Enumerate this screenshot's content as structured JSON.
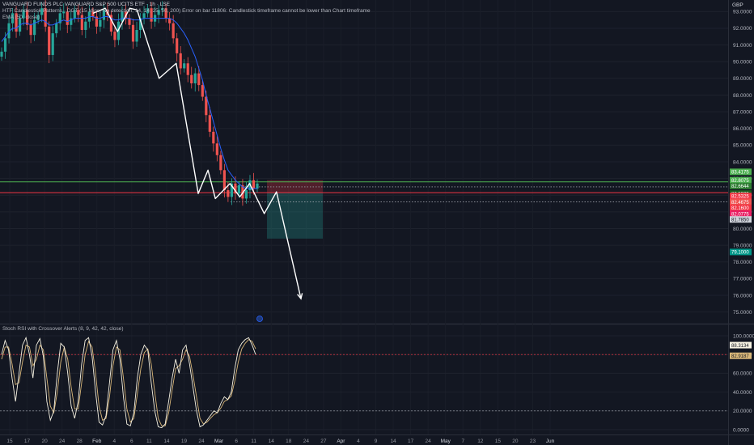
{
  "header": {
    "title": "VANGUARD FUNDS PLC VANGUARD S&P 500 UCITS ETF · 1h · LSE",
    "pattern_indicator": "HTF Candlestick Patterns · DGT (15 Mins, No detection, 14, 14, 25, 50, 200) Error on bar 11806: Candlestick timeframe cannot be lower than Chart timeframe",
    "ema_indicator": "EMA (50, close)",
    "currency": "GBP"
  },
  "chart_data": [
    {
      "type": "candlestick",
      "title": "VANGUARD FUNDS PLC VANGUARD S&P 500 UCITS ETF · 1h · LSE",
      "currency": "GBP",
      "yticks": [
        "93.0000",
        "92.0000",
        "91.0000",
        "90.0000",
        "89.0000",
        "88.0000",
        "87.0000",
        "86.0000",
        "85.0000",
        "84.0000",
        "83.0000",
        "82.0000",
        "81.0000",
        "80.0000",
        "79.0000",
        "78.0000",
        "77.0000",
        "76.0000",
        "75.0000"
      ],
      "ylim": [
        74.5,
        93.5
      ],
      "xticks": [
        "15",
        "17",
        "20",
        "24",
        "28",
        "Feb",
        "4",
        "6",
        "11",
        "14",
        "19",
        "24",
        "Mar",
        "6",
        "11",
        "14",
        "18",
        "24",
        "27",
        "Apr",
        "4",
        "9",
        "14",
        "17",
        "24",
        "May",
        "7",
        "12",
        "15",
        "20",
        "23",
        "Jun"
      ],
      "series": [
        {
          "type": "candles",
          "color_up": "#26a69a",
          "color_down": "#ef5350",
          "closes": [
            90.6,
            91.4,
            92.3,
            92.9,
            91.8,
            92.6,
            93.1,
            92.2,
            91.6,
            92.5,
            92.8,
            93.2,
            92.1,
            90.4,
            91.7,
            92.3,
            92.9,
            93.0,
            92.2,
            92.6,
            93.1,
            92.8,
            91.9,
            92.4,
            93.0,
            92.7,
            92.1,
            92.5,
            93.1,
            92.8,
            91.8,
            91.3,
            92.4,
            93.0,
            92.6,
            92.2,
            91.2,
            91.9,
            92.6,
            92.9,
            93.2,
            92.4,
            92.8,
            93.1,
            93.2,
            92.6,
            92.3,
            91.4,
            90.5,
            89.6,
            89.9,
            89.2,
            88.7,
            89.3,
            88.6,
            87.9,
            86.8,
            85.8,
            85.1,
            84.4,
            83.5,
            82.3,
            81.9,
            82.7,
            82.1,
            82.6,
            81.8,
            82.3,
            82.9,
            82.4,
            82.7
          ]
        },
        {
          "type": "line",
          "name": "EMA (50, close)",
          "color": "#2962ff",
          "values": [
            91.2,
            91.5,
            91.8,
            92.0,
            92.0,
            92.2,
            92.3,
            92.3,
            92.2,
            92.3,
            92.4,
            92.5,
            92.4,
            92.2,
            92.2,
            92.3,
            92.4,
            92.5,
            92.4,
            92.5,
            92.6,
            92.6,
            92.6,
            92.6,
            92.7,
            92.7,
            92.6,
            92.6,
            92.7,
            92.7,
            92.6,
            92.5,
            92.5,
            92.6,
            92.6,
            92.6,
            92.5,
            92.5,
            92.5,
            92.6,
            92.6,
            92.6,
            92.6,
            92.6,
            92.6,
            92.6,
            92.6,
            92.5,
            92.3,
            92.0,
            91.7,
            91.3,
            90.8,
            90.3,
            89.6,
            88.9,
            88.0,
            87.2,
            86.4,
            85.6,
            84.8,
            84.1,
            83.5,
            83.2,
            82.9,
            82.7,
            82.5,
            82.4,
            82.4,
            82.4,
            82.4
          ]
        },
        {
          "type": "path",
          "name": "drawing",
          "color": "#ffffff",
          "points": [
            [
              92.3,
              92.9
            ],
            [
              92.8,
              93.2
            ],
            [
              93.3,
              91.8
            ],
            [
              93.8,
              93.2
            ],
            [
              94.1,
              93.1
            ],
            [
              95.0,
              89.0
            ],
            [
              95.7,
              89.9
            ],
            [
              96.6,
              82.1
            ],
            [
              97.0,
              83.5
            ],
            [
              97.3,
              81.8
            ],
            [
              97.9,
              82.7
            ],
            [
              98.3,
              81.9
            ],
            [
              98.7,
              82.7
            ],
            [
              99.3,
              80.9
            ],
            [
              99.8,
              82.2
            ],
            [
              100.8,
              75.8
            ]
          ]
        }
      ],
      "horizontal_lines": [
        {
          "value": 82.8,
          "color": "#4caf50"
        },
        {
          "value": 82.15,
          "color": "#f23645"
        },
        {
          "value": 82.5,
          "color": "#9598a1",
          "style": "dotted"
        },
        {
          "value": 81.6,
          "color": "#b2b5be",
          "style": "dotted"
        }
      ],
      "position_tool": {
        "entry": 82.15,
        "stop": 82.9,
        "target": 79.4
      },
      "price_labels": [
        {
          "text": "83.4175",
          "color": "#4caf50",
          "value": 83.4
        },
        {
          "text": "82.8075",
          "color": "#4caf50",
          "value": 82.9
        },
        {
          "text": "82.6644",
          "color": "#2e7d32",
          "value": 82.55
        },
        {
          "text": "82.5325",
          "color": "#1b5e20",
          "value": 82.1
        },
        {
          "text": "82.5325",
          "color": "#f23645",
          "value": 81.95
        },
        {
          "text": "82.4675",
          "color": "#ef5350",
          "value": 81.6
        },
        {
          "text": "82.1600",
          "color": "#f23645",
          "value": 81.25
        },
        {
          "text": "82.0775",
          "color": "#e91e63",
          "value": 80.9
        },
        {
          "text": "81.7850",
          "color": "#d1d4dc",
          "value": 80.55
        },
        {
          "text": "79.1000",
          "color": "#009688",
          "value": 78.6
        }
      ]
    },
    {
      "type": "line",
      "title": "Stoch RSI with Crossover Alerts (8, 9, 42, 42, close)",
      "ylim": [
        0,
        100
      ],
      "yticks": [
        "100.0000",
        "80.0000",
        "60.0000",
        "40.0000",
        "20.0000",
        "0.0000"
      ],
      "upper_band": 80,
      "lower_band": 20,
      "series": [
        {
          "name": "K",
          "color": "#f7f3e3",
          "values": [
            80,
            95,
            85,
            55,
            30,
            60,
            90,
            98,
            80,
            55,
            90,
            97,
            78,
            30,
            10,
            20,
            60,
            92,
            88,
            60,
            25,
            12,
            30,
            70,
            95,
            98,
            78,
            40,
            8,
            5,
            15,
            50,
            85,
            95,
            75,
            35,
            6,
            4,
            18,
            55,
            80,
            90,
            85,
            50,
            20,
            3,
            2,
            6,
            30,
            55,
            75,
            60,
            85,
            90,
            70,
            45,
            20,
            3,
            5,
            10,
            15,
            20,
            18,
            28,
            35,
            32,
            40,
            65,
            85,
            92,
            96,
            98,
            90,
            80
          ]
        },
        {
          "name": "D",
          "color": "#d9b779",
          "values": [
            75,
            88,
            88,
            70,
            48,
            50,
            72,
            90,
            88,
            68,
            75,
            90,
            85,
            55,
            25,
            18,
            40,
            72,
            88,
            75,
            45,
            22,
            22,
            50,
            80,
            94,
            88,
            60,
            25,
            10,
            12,
            35,
            68,
            88,
            85,
            55,
            22,
            8,
            12,
            38,
            65,
            82,
            86,
            70,
            40,
            12,
            4,
            4,
            18,
            42,
            65,
            68,
            75,
            85,
            78,
            58,
            35,
            12,
            6,
            8,
            12,
            16,
            18,
            23,
            30,
            32,
            36,
            52,
            72,
            86,
            92,
            96,
            94,
            86
          ]
        }
      ],
      "value_labels": [
        {
          "text": "88.3134",
          "value": 88.3
        },
        {
          "text": "82.9187",
          "value": 83.0
        }
      ]
    }
  ]
}
